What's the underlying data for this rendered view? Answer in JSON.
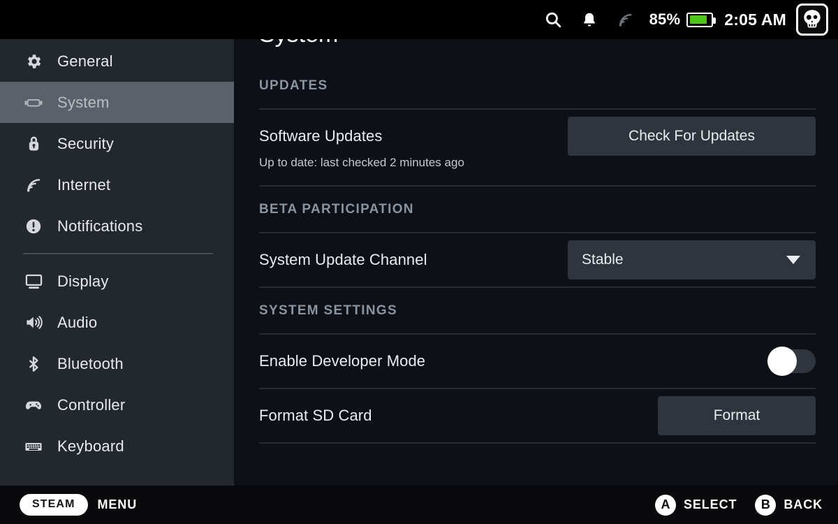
{
  "statusbar": {
    "icons": [
      "search-icon",
      "bell-icon",
      "wifi-signal-icon"
    ],
    "battery_percent": "85%",
    "battery_level": 85,
    "battery_color": "#4fc51c",
    "time": "2:05 AM",
    "avatar": "skull-avatar",
    "avatar_accent_color": "#2d6fd4"
  },
  "sidebar": {
    "highlight_color": "#5b6169",
    "groups": [
      {
        "items": [
          {
            "label": "General",
            "icon": "gear-icon",
            "active": false
          },
          {
            "label": "System",
            "icon": "handheld-device-icon",
            "active": true
          },
          {
            "label": "Security",
            "icon": "lock-icon",
            "active": false
          },
          {
            "label": "Internet",
            "icon": "wifi-icon",
            "active": false
          },
          {
            "label": "Notifications",
            "icon": "alert-circle-icon",
            "active": false
          }
        ]
      },
      {
        "items": [
          {
            "label": "Display",
            "icon": "monitor-icon",
            "active": false
          },
          {
            "label": "Audio",
            "icon": "speaker-icon",
            "active": false
          },
          {
            "label": "Bluetooth",
            "icon": "bluetooth-icon",
            "active": false
          },
          {
            "label": "Controller",
            "icon": "gamepad-icon",
            "active": false
          },
          {
            "label": "Keyboard",
            "icon": "keyboard-icon",
            "active": false
          }
        ]
      }
    ]
  },
  "content": {
    "clipped_title": "System",
    "sections": [
      {
        "heading": "UPDATES",
        "rows": [
          {
            "label": "Software Updates",
            "control": "button",
            "control_label": "Check For Updates",
            "note": "Up to date: last checked 2 minutes ago"
          }
        ]
      },
      {
        "heading": "BETA PARTICIPATION",
        "rows": [
          {
            "label": "System Update Channel",
            "control": "dropdown",
            "control_label": "Stable"
          }
        ]
      },
      {
        "heading": "SYSTEM SETTINGS",
        "rows": [
          {
            "label": "Enable Developer Mode",
            "control": "toggle",
            "control_state": "off"
          },
          {
            "label": "Format SD Card",
            "control": "button",
            "control_label": "Format"
          }
        ]
      }
    ]
  },
  "footer": {
    "steam_pill": "STEAM",
    "menu_label": "MENU",
    "hints": [
      {
        "glyph": "A",
        "label": "SELECT"
      },
      {
        "glyph": "B",
        "label": "BACK"
      }
    ]
  }
}
